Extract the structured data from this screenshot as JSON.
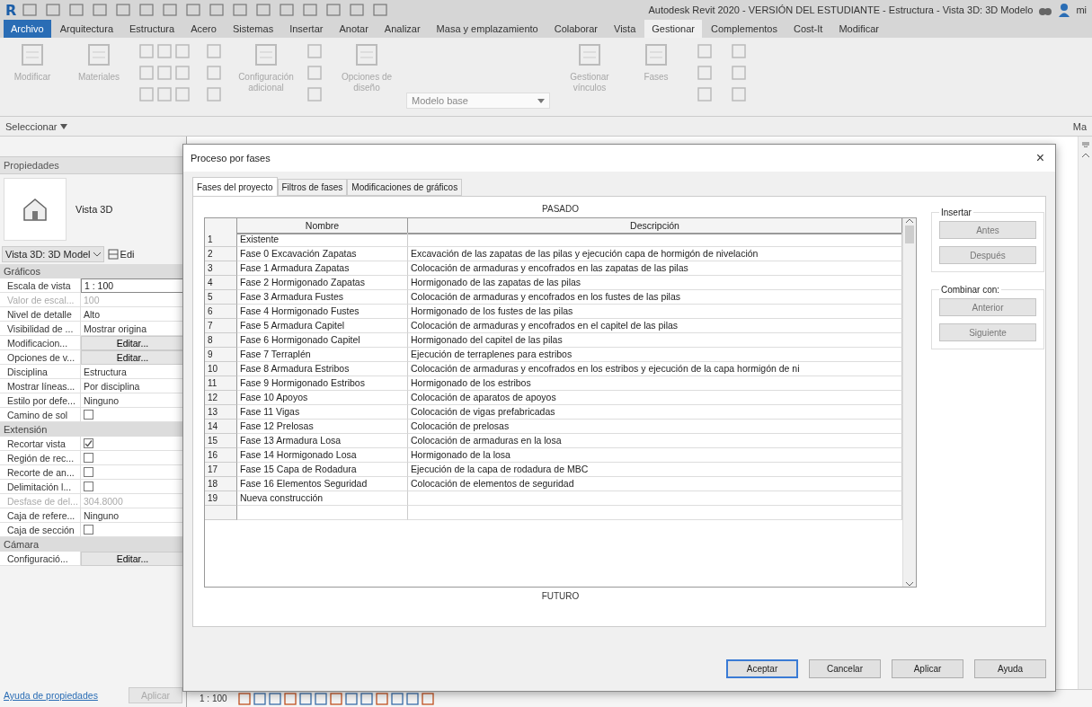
{
  "window": {
    "logo": "R",
    "title": "Autodesk Revit 2020 - VERSIÓN DEL ESTUDIANTE - Estructura - Vista 3D: 3D Modelo",
    "user": "mi"
  },
  "ribbon_tabs": [
    {
      "label": "Archivo",
      "kind": "file",
      "selected": false
    },
    {
      "label": "Arquitectura",
      "kind": "tab",
      "selected": false
    },
    {
      "label": "Estructura",
      "kind": "tab",
      "selected": false
    },
    {
      "label": "Acero",
      "kind": "tab",
      "selected": false
    },
    {
      "label": "Sistemas",
      "kind": "tab",
      "selected": false
    },
    {
      "label": "Insertar",
      "kind": "tab",
      "selected": false
    },
    {
      "label": "Anotar",
      "kind": "tab",
      "selected": false
    },
    {
      "label": "Analizar",
      "kind": "tab",
      "selected": false
    },
    {
      "label": "Masa y emplazamiento",
      "kind": "tab",
      "selected": false
    },
    {
      "label": "Colaborar",
      "kind": "tab",
      "selected": false
    },
    {
      "label": "Vista",
      "kind": "tab",
      "selected": false
    },
    {
      "label": "Gestionar",
      "kind": "tab",
      "selected": true
    },
    {
      "label": "Complementos",
      "kind": "tab",
      "selected": false
    },
    {
      "label": "Cost-It",
      "kind": "tab",
      "selected": false
    },
    {
      "label": "Modificar",
      "kind": "tab",
      "selected": false
    }
  ],
  "ribbon_tools": [
    {
      "kind": "large",
      "label": "Modificar"
    },
    {
      "kind": "large",
      "label": "Materiales"
    },
    {
      "kind": "grid"
    },
    {
      "kind": "stack"
    },
    {
      "kind": "large",
      "label": "Configuración adicional"
    },
    {
      "kind": "stack"
    },
    {
      "kind": "large",
      "label": "Opciones de diseño"
    },
    {
      "kind": "dropdown",
      "label": "Modelo base"
    },
    {
      "kind": "large",
      "label": "Gestionar vínculos"
    },
    {
      "kind": "large",
      "label": "Fases"
    },
    {
      "kind": "stack"
    },
    {
      "kind": "stack"
    }
  ],
  "panel_bar": {
    "label": "Seleccionar",
    "right_label": "Ma"
  },
  "properties": {
    "title": "Propiedades",
    "type_name": "Vista 3D",
    "type_selector": "Vista 3D: 3D Model",
    "edit_type": "Edi",
    "groups": [
      {
        "name": "Gráficos",
        "rows": [
          {
            "label": "Escala de vista",
            "kind": "input",
            "value": "1 : 100",
            "disabled": false
          },
          {
            "label": "Valor de escal...",
            "kind": "text",
            "value": "100",
            "disabled": true
          },
          {
            "label": "Nivel de detalle",
            "kind": "text",
            "value": "Alto",
            "disabled": false
          },
          {
            "label": "Visibilidad de ...",
            "kind": "text",
            "value": "Mostrar origina",
            "disabled": false
          },
          {
            "label": "Modificacion...",
            "kind": "button",
            "value": "Editar...",
            "disabled": false
          },
          {
            "label": "Opciones de v...",
            "kind": "button",
            "value": "Editar...",
            "disabled": false
          },
          {
            "label": "Disciplina",
            "kind": "text",
            "value": "Estructura",
            "disabled": false
          },
          {
            "label": "Mostrar líneas...",
            "kind": "text",
            "value": "Por disciplina",
            "disabled": false
          },
          {
            "label": "Estilo por defe...",
            "kind": "text",
            "value": "Ninguno",
            "disabled": false
          },
          {
            "label": "Camino de sol",
            "kind": "checkbox",
            "checked": false,
            "disabled": false
          }
        ]
      },
      {
        "name": "Extensión",
        "rows": [
          {
            "label": "Recortar vista",
            "kind": "checkbox",
            "checked": true,
            "disabled": false
          },
          {
            "label": "Región de rec...",
            "kind": "checkbox",
            "checked": false,
            "disabled": false
          },
          {
            "label": "Recorte de an...",
            "kind": "checkbox",
            "checked": false,
            "disabled": false
          },
          {
            "label": "Delimitación l...",
            "kind": "checkbox",
            "checked": false,
            "disabled": false
          },
          {
            "label": "Desfase de del...",
            "kind": "text",
            "value": "304.8000",
            "disabled": true
          },
          {
            "label": "Caja de refere...",
            "kind": "text",
            "value": "Ninguno",
            "disabled": false
          },
          {
            "label": "Caja de sección",
            "kind": "checkbox",
            "checked": false,
            "disabled": false
          }
        ]
      },
      {
        "name": "Cámara",
        "rows": [
          {
            "label": "Configuració...",
            "kind": "button",
            "value": "Editar...",
            "disabled": false
          }
        ]
      }
    ],
    "help_link": "Ayuda de propiedades",
    "apply": {
      "label": "Aplicar",
      "disabled": true
    }
  },
  "view_bar": {
    "scale": "1 : 100"
  },
  "dialog": {
    "title": "Proceso por fases",
    "close": "×",
    "tabs": [
      {
        "label": "Fases del proyecto",
        "selected": true
      },
      {
        "label": "Filtros de fases",
        "selected": false
      },
      {
        "label": "Modificaciones de gráficos",
        "selected": false
      }
    ],
    "past_label": "PASADO",
    "future_label": "FUTURO",
    "columns": [
      "Nombre",
      "Descripción"
    ],
    "rows": [
      {
        "number": "1",
        "name": "Existente",
        "description": ""
      },
      {
        "number": "2",
        "name": "Fase 0 Excavación Zapatas",
        "description": "Excavación de las zapatas de las pilas y ejecución capa de hormigón de nivelación"
      },
      {
        "number": "3",
        "name": "Fase 1 Armadura Zapatas",
        "description": "Colocación de armaduras y encofrados en las zapatas de las pilas"
      },
      {
        "number": "4",
        "name": "Fase 2 Hormigonado Zapatas",
        "description": "Hormigonado de las zapatas de las pilas"
      },
      {
        "number": "5",
        "name": "Fase 3 Armadura Fustes",
        "description": "Colocación de armaduras y encofrados en los fustes de las pilas"
      },
      {
        "number": "6",
        "name": "Fase 4 Hormigonado Fustes",
        "description": "Hormigonado de los fustes de las pilas"
      },
      {
        "number": "7",
        "name": "Fase 5 Armadura Capitel",
        "description": "Colocación de armaduras y encofrados en el capitel de las pilas"
      },
      {
        "number": "8",
        "name": "Fase 6 Hormigonado Capitel",
        "description": "Hormigonado del capitel de las pilas"
      },
      {
        "number": "9",
        "name": "Fase 7 Terraplén",
        "description": "Ejecución de terraplenes para estribos"
      },
      {
        "number": "10",
        "name": "Fase 8 Armadura Estribos",
        "description": "Colocación de armaduras y encofrados en los estribos y ejecución de la capa hormigón de ni"
      },
      {
        "number": "11",
        "name": "Fase 9 Hormigonado Estribos",
        "description": "Hormigonado de los estribos"
      },
      {
        "number": "12",
        "name": "Fase 10 Apoyos",
        "description": "Colocación de aparatos de apoyos"
      },
      {
        "number": "13",
        "name": "Fase 11 Vigas",
        "description": "Colocación de vigas prefabricadas"
      },
      {
        "number": "14",
        "name": "Fase 12 Prelosas",
        "description": "Colocación de prelosas"
      },
      {
        "number": "15",
        "name": "Fase 13 Armadura Losa",
        "description": "Colocación de armaduras en la losa"
      },
      {
        "number": "16",
        "name": "Fase 14 Hormigonado Losa",
        "description": "Hormigonado de la losa"
      },
      {
        "number": "17",
        "name": "Fase 15 Capa de Rodadura",
        "description": "Ejecución de la capa de rodadura de MBC"
      },
      {
        "number": "18",
        "name": "Fase 16 Elementos Seguridad",
        "description": "Colocación de elementos de seguridad"
      },
      {
        "number": "19",
        "name": "Nueva construcción",
        "description": ""
      }
    ],
    "side_groups": [
      {
        "title": "Insertar",
        "buttons": [
          {
            "label": "Antes",
            "disabled": true
          },
          {
            "label": "Después",
            "disabled": true
          }
        ]
      },
      {
        "title": "Combinar con:",
        "buttons": [
          {
            "label": "Anterior",
            "disabled": true
          },
          {
            "label": "Siguiente",
            "disabled": true
          }
        ]
      }
    ],
    "buttons": [
      {
        "label": "Aceptar",
        "default": true
      },
      {
        "label": "Cancelar",
        "default": false
      },
      {
        "label": "Aplicar",
        "default": false
      },
      {
        "label": "Ayuda",
        "default": false
      }
    ]
  }
}
